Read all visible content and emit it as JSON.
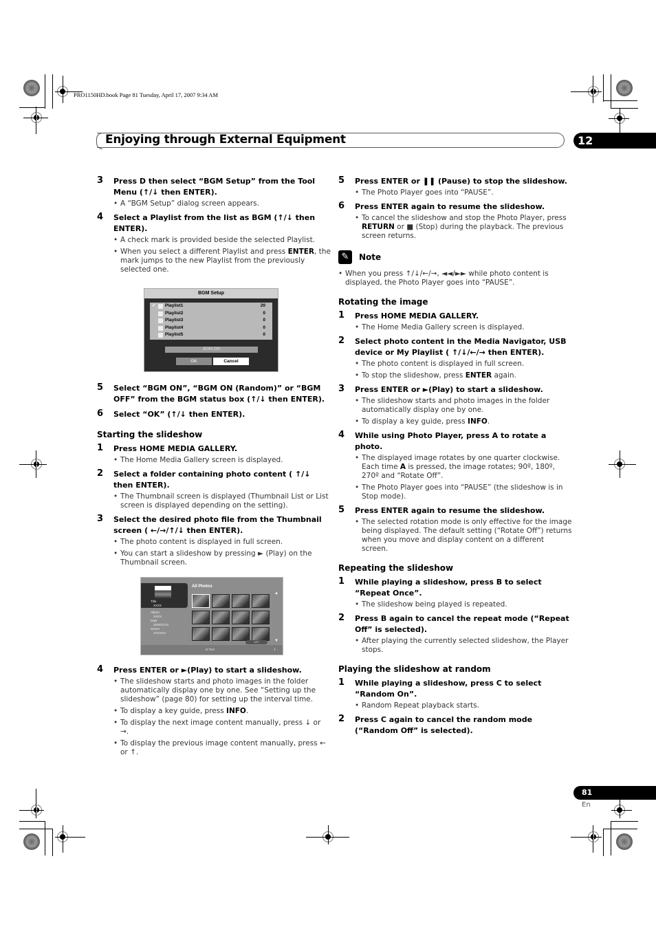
{
  "slug": "PRO1150HD.book  Page 81  Tuesday, April 17, 2007  9:34 AM",
  "header": {
    "title": "Enjoying through External Equipment",
    "chapter": "12"
  },
  "footer": {
    "page": "81",
    "lang": "En"
  },
  "left": {
    "s3": {
      "num": "3",
      "text": "Press D then select “BGM Setup” from the Tool Menu (↑/↓ then ENTER).",
      "bullets": [
        "A “BGM Setup” dialog screen appears."
      ]
    },
    "s4": {
      "num": "4",
      "text": "Select a Playlist from the list as BGM (↑/↓ then ENTER).",
      "b1": "A check mark is provided beside the selected Playlist.",
      "b2_pre": "When you select a different Playlist and press ",
      "b2_key": "ENTER",
      "b2_post": ", the mark jumps to the new Playlist from the previously selected one."
    },
    "bgm": {
      "title": "BGM Setup",
      "playlists": [
        {
          "name": "Playlist1",
          "count": "20",
          "checked": "✔"
        },
        {
          "name": "Playlist2",
          "count": "0",
          "checked": ""
        },
        {
          "name": "Playlist3",
          "count": "0",
          "checked": ""
        },
        {
          "name": "Playlist4",
          "count": "0",
          "checked": ""
        },
        {
          "name": "Playlist5",
          "count": "0",
          "checked": ""
        }
      ],
      "status": "BGM ON",
      "ok": "OK",
      "cancel": "Cancel"
    },
    "s5": {
      "num": "5",
      "text": "Select “BGM ON”, “BGM ON (Random)” or “BGM OFF” from the BGM status box (↑/↓ then ENTER)."
    },
    "s6": {
      "num": "6",
      "text": "Select “OK” (↑/↓ then ENTER)."
    },
    "section": "Starting the slideshow",
    "ss1": {
      "num": "1",
      "text": "Press HOME MEDIA GALLERY.",
      "b1": "The Home Media Gallery screen is displayed."
    },
    "ss2": {
      "num": "2",
      "text": "Select a folder containing photo content ( ↑/↓ then ENTER).",
      "b1": "The Thumbnail screen is displayed (Thumbnail List or List screen is displayed depending on the setting)."
    },
    "ss3": {
      "num": "3",
      "text": "Select the desired photo file from the Thumbnail screen ( ←/→/↑/↓ then ENTER).",
      "b1": " The photo content is displayed in full screen.",
      "b2": "You can start a slideshow by pressing ► (Play) on the Thumbnail screen."
    },
    "thumbs": {
      "title": "All Photos",
      "meta": [
        "Title",
        "XXXX",
        "Album",
        "XXXX",
        "Date",
        "2006/11/10",
        "Server",
        "XXXXXX"
      ],
      "counter": "1/27",
      "tool": "D Tool",
      "page": "1"
    },
    "ss4": {
      "num": "4",
      "text": "Press ENTER or ►(Play) to start a slideshow.",
      "b1": "The slideshow starts and photo images in the folder automatically display one by one. See “Setting up the slideshow” (page 80) for setting up the interval time.",
      "b2_pre": "To display a key guide, press ",
      "b2_key": "INFO",
      "b2_post": ".",
      "b3": "To display the next image content manually, press ↓ or →.",
      "b4": "To display the previous image content manually, press ← or ↑."
    }
  },
  "right": {
    "s5": {
      "num": "5",
      "text": "Press ENTER or ❚❚ (Pause) to stop the slideshow.",
      "b1": "The Photo Player goes into “PAUSE”."
    },
    "s6": {
      "num": "6",
      "text": "Press ENTER again to resume the slideshow.",
      "b1_key": "RETURN",
      "b1_pre": "To cancel the slideshow and stop the Photo Player, press ",
      "b1_mid": " or ■ (Stop) during the playback. The previous screen returns."
    },
    "note": {
      "label": "Note",
      "icon": "✎",
      "b1": "When you press ↑/↓/←/→, ◄◄/►► while photo content is displayed, the Photo Player goes into “PAUSE”."
    },
    "rot": {
      "heading": "Rotating the image",
      "s1": {
        "num": "1",
        "text": "Press HOME MEDIA GALLERY.",
        "b1": "The Home Media Gallery screen is displayed."
      },
      "s2": {
        "num": "2",
        "text": "Select photo content in the Media Navigator, USB device or My Playlist ( ↑/↓/←/→ then ENTER).",
        "b1": "The photo content is displayed in full screen.",
        "b2_pre": "To stop the slideshow, press ",
        "b2_key": "ENTER",
        "b2_post": " again."
      },
      "s3": {
        "num": "3",
        "text": "Press ENTER or ►(Play) to start a slideshow.",
        "b1": "The slideshow starts and photo images in the folder automatically display one by one.",
        "b2_pre": "To display a key guide, press ",
        "b2_key": "INFO",
        "b2_post": "."
      },
      "s4": {
        "num": "4",
        "text": "While using Photo Player, press A to rotate a photo.",
        "b1_pre": "The displayed image rotates by one quarter clockwise. Each time ",
        "b1_key": "A",
        "b1_post": " is pressed, the image rotates; 90º, 180º, 270º and “Rotate Off”.",
        "b2": "The Photo Player goes into “PAUSE” (the slideshow is in Stop mode)."
      },
      "s5": {
        "num": "5",
        "text": "Press ENTER again to resume the slideshow.",
        "b1": "The selected rotation mode is only effective for the image being displayed. The default setting (“Rotate Off”) returns when you move and display content on a different screen."
      }
    },
    "rep": {
      "heading": "Repeating the slideshow",
      "s1": {
        "num": "1",
        "text": "While playing a slideshow, press B to select “Repeat Once”.",
        "b1": "The slideshow being played is repeated."
      },
      "s2": {
        "num": "2",
        "text": "Press B again to cancel the repeat mode (“Repeat Off” is selected).",
        "b1": "After playing the currently selected slideshow, the Player stops."
      }
    },
    "rnd": {
      "heading": "Playing the slideshow at random",
      "s1": {
        "num": "1",
        "text": "While playing a slideshow, press C to select “Random On”.",
        "b1": "Random Repeat playback starts."
      },
      "s2": {
        "num": "2",
        "text": "Press C again to cancel the random mode (“Random Off” is selected)."
      }
    }
  }
}
